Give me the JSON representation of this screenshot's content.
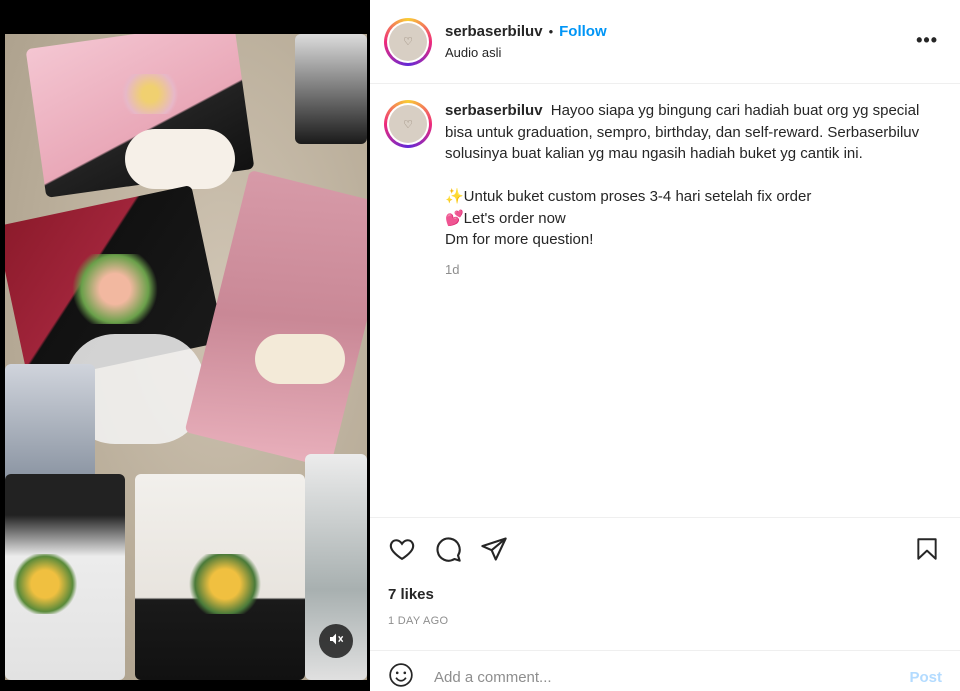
{
  "post": {
    "username": "serbaserbiluv",
    "separator": "•",
    "follow_label": "Follow",
    "audio": "Audio asli",
    "more_label": "•••"
  },
  "caption": {
    "username": "serbaserbiluv",
    "line1": "Hayoo siapa yg bingung cari hadiah buat org yg special bisa untuk graduation, sempro, birthday, dan self-reward. Serbaserbiluv solusinya buat kalian yg mau ngasih hadiah buket yg cantik ini.",
    "line2": "✨Untuk buket custom proses 3-4 hari setelah fix order",
    "line3": "💕Let's order now",
    "line4": "Dm for more question!",
    "time": "1d"
  },
  "stats": {
    "likes": "7 likes",
    "posted": "1 DAY AGO"
  },
  "comment": {
    "placeholder": "Add a comment...",
    "post_label": "Post"
  },
  "icons": {
    "like": "heart-icon",
    "comment": "comment-icon",
    "share": "share-icon",
    "save": "bookmark-icon",
    "emoji": "emoji-icon",
    "mute": "mute-icon"
  },
  "colors": {
    "accent": "#0095f6",
    "post_disabled": "#b3dbff",
    "muted_text": "#8e8e8e"
  }
}
